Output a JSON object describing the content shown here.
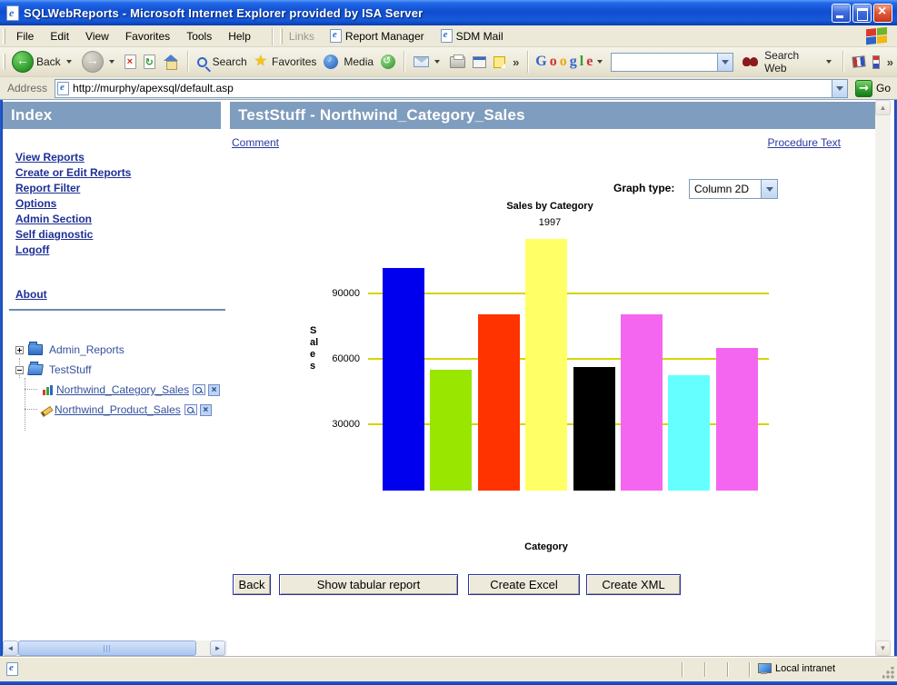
{
  "window": {
    "title": "SQLWebReports - Microsoft Internet Explorer provided by ISA Server"
  },
  "menubar": {
    "items": [
      "File",
      "Edit",
      "View",
      "Favorites",
      "Tools",
      "Help"
    ],
    "links_label": "Links",
    "link_items": [
      "Report Manager",
      "SDM Mail"
    ]
  },
  "toolbar": {
    "back_label": "Back",
    "search_label": "Search",
    "favorites_label": "Favorites",
    "media_label": "Media",
    "google_letters": [
      "G",
      "o",
      "o",
      "g",
      "l",
      "e"
    ],
    "search_web_label": "Search Web"
  },
  "addressbar": {
    "label": "Address",
    "url": "http://murphy/apexsql/default.asp",
    "go_label": "Go"
  },
  "sidebar": {
    "header": "Index",
    "links": [
      "View Reports",
      "Create or Edit Reports",
      "Report Filter",
      "Options",
      "Admin Section",
      "Self diagnostic",
      "Logoff"
    ],
    "about_label": "About",
    "tree": {
      "folder1": "Admin_Reports",
      "folder2": "TestStuff",
      "report1": "Northwind_Category_Sales",
      "report2": "Northwind_Product_Sales"
    }
  },
  "main": {
    "header": "TestStuff - Northwind_Category_Sales",
    "comment_label": "Comment",
    "procedure_label": "Procedure Text",
    "graph_type_label": "Graph type:",
    "graph_type_value": "Column 2D",
    "back_button": "Back",
    "tabular_button": "Show tabular report",
    "excel_button": "Create Excel",
    "xml_button": "Create XML"
  },
  "statusbar": {
    "zone_label": "Local intranet"
  },
  "chart_data": {
    "type": "bar",
    "title": "Sales by Category",
    "subtitle": "1997",
    "xlabel": "Category",
    "ylabel": "Sales",
    "values": [
      102000,
      55500,
      81000,
      115500,
      56500,
      81000,
      53000,
      65500
    ],
    "bar_colors": [
      "#0000EE",
      "#99E600",
      "#FF3300",
      "#FFFF66",
      "#000000",
      "#F566F0",
      "#66FFFF",
      "#F566F0"
    ],
    "yticks": [
      90000,
      60000,
      30000
    ],
    "ytick_labels": [
      "90000",
      "60000",
      "30000"
    ],
    "ylim": [
      0,
      120000
    ],
    "grid": true,
    "gridline_color": "#D4D400",
    "legend": false,
    "x_tick_labels_visible": false
  }
}
